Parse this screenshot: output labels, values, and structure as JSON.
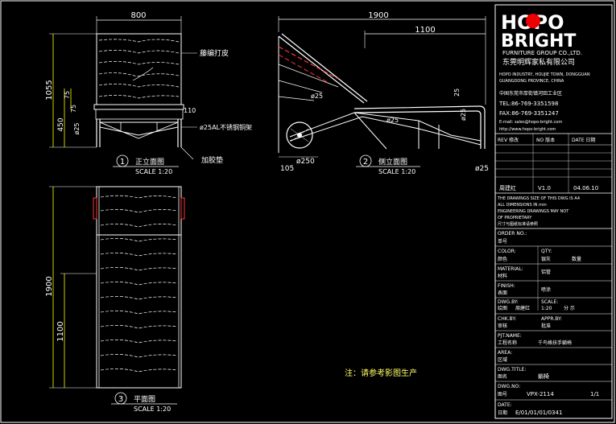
{
  "views": {
    "front": {
      "width_dim": "800",
      "height_dim": "1055",
      "dim_75": "75",
      "dim_450": "450",
      "dim_110": "110",
      "dim_25": "ø25",
      "num": "1",
      "title": "正立面图",
      "scale": "SCALE 1:20"
    },
    "side": {
      "length_dim": "1900",
      "dim_1100": "1100",
      "dim_25a": "ø25",
      "dim_25b": "ø25",
      "dim_25c": "25",
      "dim_25d": "ø25",
      "dim_25e": "ø25",
      "dim_105": "105",
      "wheel_dim": "ø250",
      "num": "2",
      "title": "侧立面图",
      "scale": "SCALE 1:20"
    },
    "plan": {
      "length_dim": "1900",
      "dim_1100": "1100",
      "num": "3",
      "title": "平面图",
      "scale": "SCALE 1:20"
    }
  },
  "callouts": {
    "mesh": "藤编打皮",
    "tube": "ø25AL不锈钢铜架",
    "pad": "加胶垫"
  },
  "note": "注：请参考影图生产",
  "title_block": {
    "logo_top": "HOPO",
    "logo_bottom": "BRIGHT",
    "logo_sub": "FURNITURE GROUP CO.,LTD.",
    "company_cn": "东莞明辉家私有限公司",
    "address_en1": "HOPO INDUSTRY, HOUJIE TOWN, DONGGUAN",
    "address_en2": "GUANGDONG PROVINCE, CHINA",
    "address_cn": "中国东莞市厚街镇河田工业区",
    "tel": "TEL:86-769-3351598",
    "fax": "FAX:86-769-3351247",
    "email": "E-mail: sales@hopo-bright.com",
    "web": "http://www.hopo-bright.com",
    "rev_label": "REV 修改",
    "no_label": "NO 版本",
    "date_label": "DATE 日期",
    "rev_value": "周建红",
    "rev_no": "V1.0",
    "rev_date": "04.06.10",
    "disclaimer1": "THE DRAWINGS SIZE OF THIS DWG IS A4",
    "disclaimer2": "ALL DIMENSIONS IN mm",
    "disclaimer3": "ENGINEERING DRAWINGS MAY NOT",
    "disclaimer4": "OF PROPRIETARY",
    "disclaimer5": "尺寸与图纸标准请参照",
    "order_label": "ORDER NO.:",
    "order_cn": "单号",
    "color_label": "COLOR:",
    "color_cn": "颜色",
    "color_val": "银灰",
    "qty_label": "QTY:",
    "qty_val": "数量",
    "material_label": "MATERIAL:",
    "material_cn": "材料",
    "material_val": "铝管",
    "finish_label": "FINISH:",
    "finish_cn": "表面",
    "finish_val": "喷涂",
    "dwg_by_label": "DWG.BY:",
    "dwg_by_cn": "绘图",
    "dwg_by_val": "周建红",
    "scale_label": "SCALE:",
    "scale_val": "1:20",
    "scale_cn": "分 示",
    "chk_label": "CHK.BY:",
    "chk_cn": "审核",
    "appr_label": "APPR.BY:",
    "appr_cn": "批准",
    "prj_label": "PJT.NAME:",
    "prj_cn": "工程名称",
    "prj_val": "千鸟格扶手躺椅",
    "area_label": "AREA:",
    "area_cn": "区域",
    "title_label": "DWG.TITLE:",
    "title_cn": "图名",
    "title_val": "躺椅",
    "dwg_no_label": "DWG.NO:",
    "dwg_no_cn": "图号",
    "dwg_no_val": "VPX-2114",
    "sheet_val": "1/1",
    "date_label2": "DATE:",
    "date_cn": "日期",
    "date_val": "E/01/01/01/0341"
  }
}
